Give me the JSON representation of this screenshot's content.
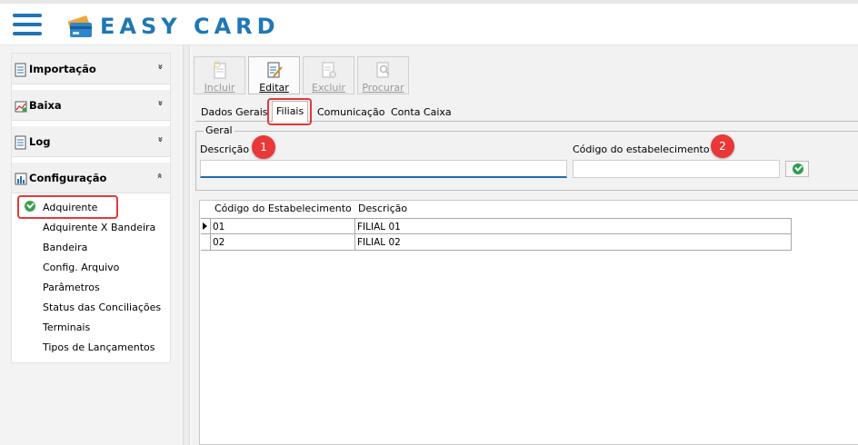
{
  "app": {
    "title": "EASY CARD"
  },
  "sidebar": {
    "sections": [
      {
        "label": "Importação",
        "chevron": "»",
        "icon": "document-icon",
        "expanded": false
      },
      {
        "label": "Baixa",
        "chevron": "»",
        "icon": "chart-check-icon",
        "expanded": false
      },
      {
        "label": "Log",
        "chevron": "»",
        "icon": "document-icon",
        "expanded": false
      },
      {
        "label": "Configuração",
        "chevron": "«",
        "icon": "config-icon",
        "expanded": true
      }
    ],
    "items": [
      {
        "label": "Adquirente",
        "active": true
      },
      {
        "label": "Adquirente X Bandeira"
      },
      {
        "label": "Bandeira"
      },
      {
        "label": "Config. Arquivo"
      },
      {
        "label": "Parâmetros"
      },
      {
        "label": "Status das Conciliações"
      },
      {
        "label": "Terminais"
      },
      {
        "label": "Tipos de Lançamentos"
      }
    ]
  },
  "toolbar": {
    "buttons": [
      {
        "label": "Incluir",
        "enabled": false
      },
      {
        "label": "Editar",
        "enabled": true,
        "active": true
      },
      {
        "label": "Excluir",
        "enabled": false
      },
      {
        "label": "Procurar",
        "enabled": false
      }
    ]
  },
  "tabs": [
    {
      "label": "Dados Gerais"
    },
    {
      "label": "Filiais",
      "selected": true
    },
    {
      "label": "Comunicação"
    },
    {
      "label": "Conta Caixa"
    }
  ],
  "form": {
    "group_title": "Geral",
    "descricao_label": "Descrição",
    "descricao_value": "",
    "codigo_label": "Código do estabelecimento",
    "codigo_value": "",
    "badge1": "1",
    "badge2": "2"
  },
  "grid": {
    "columns": [
      "Código do Estabelecimento",
      "Descrição"
    ],
    "rows": [
      [
        "01",
        "FILIAL 01"
      ],
      [
        "02",
        "FILIAL 02"
      ]
    ]
  },
  "colors": {
    "brand": "#1f77b6",
    "highlight": "#e23a3a",
    "ok_green": "#2f9e4b"
  }
}
